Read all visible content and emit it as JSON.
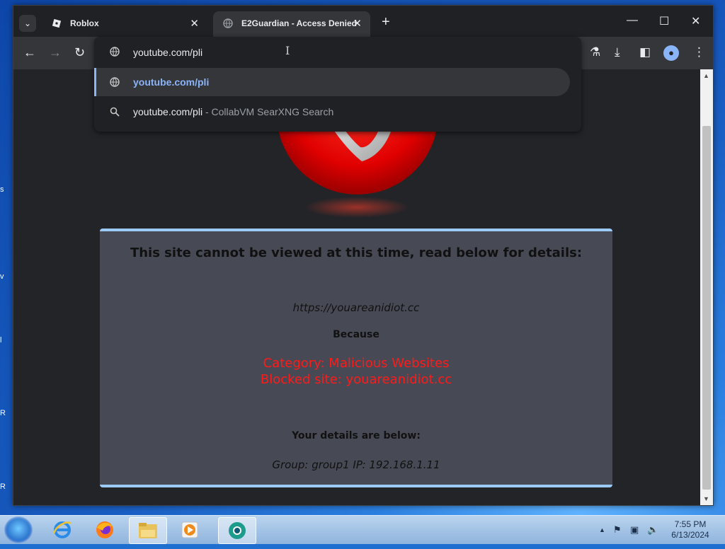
{
  "desktop": {
    "edge_labels": [
      "s",
      "v",
      "l",
      "R",
      "R"
    ]
  },
  "browser": {
    "tab_search_glyph": "⌄",
    "tabs": [
      {
        "title": "Roblox",
        "close": "✕",
        "active": false
      },
      {
        "title": "E2Guardian - Access Denied",
        "close": "✕",
        "active": true
      }
    ],
    "new_tab": "+",
    "window_controls": {
      "minimize": "—",
      "maximize": "☐",
      "close": "✕"
    },
    "toolbar": {
      "back": "←",
      "forward": "→",
      "reload": "↻",
      "labs": "⚗",
      "download": "⤓",
      "sidebar": "◧",
      "menu": "⋮"
    },
    "omnibox": {
      "input_text": "youtube.com/pli",
      "suggestions": [
        {
          "text": "youtube.com/pli",
          "extra": "",
          "icon": "globe-icon"
        },
        {
          "text": "youtube.com/pli",
          "extra": " - CollabVM SearXNG Search",
          "icon": "search-icon"
        }
      ]
    }
  },
  "page": {
    "title": "This site cannot be viewed at this time, read below for details:",
    "url": "https://youareanidiot.cc",
    "because": "Because",
    "category": "Category: Malicious Websites",
    "blocked_site": "Blocked site: youareanidiot.cc",
    "details_heading": "Your details are below:",
    "group_ip": "Group: group1   IP: 192.168.1.11"
  },
  "taskbar": {
    "items": [
      "internet-explorer",
      "firefox",
      "file-explorer",
      "media-player",
      "chrome"
    ],
    "tray_glyphs": {
      "arrow": "▲",
      "flag": "⚑",
      "network": "▣",
      "volume": "🔈"
    },
    "time": "7:55 PM",
    "date": "6/13/2024"
  },
  "colors": {
    "accent": "#8ab4f8",
    "blocked_red": "#ff1a1a",
    "panel_border": "#9ccaf6",
    "panel_bg": "#474a55"
  }
}
